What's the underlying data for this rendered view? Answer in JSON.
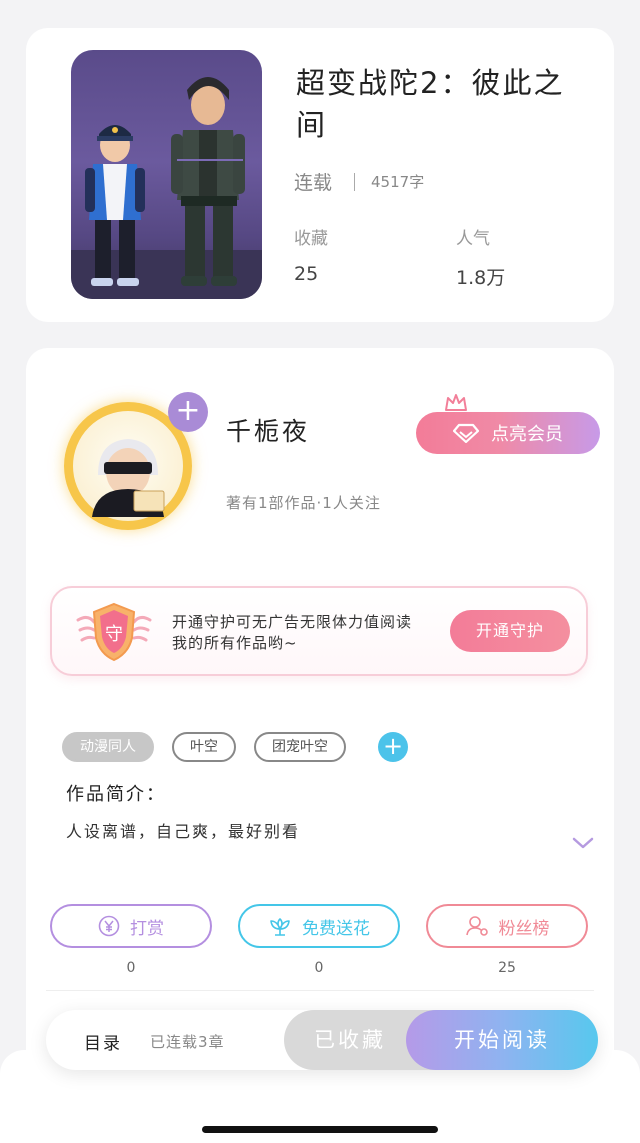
{
  "book": {
    "title": "超变战陀2：彼此之间",
    "status": "连载",
    "word_count": "4517字",
    "stats": [
      {
        "label": "收藏",
        "value": "25"
      },
      {
        "label": "人气",
        "value": "1.8万"
      }
    ]
  },
  "author": {
    "name": "千栀夜",
    "summary": "著有1部作品·1人关注",
    "vip_label": "点亮会员"
  },
  "guard": {
    "text": "开通守护可无广告无限体力值阅读我的所有作品哟~",
    "button_label": "开通守护",
    "badge_char": "守"
  },
  "tags": [
    "动漫同人",
    "叶空",
    "团宠叶空"
  ],
  "intro": {
    "label": "作品简介：",
    "text": "人设离谱，自己爽，最好别看"
  },
  "actions": [
    {
      "label": "打赏",
      "count": "0",
      "color": "#b48fe0",
      "icon": "yuan-coin-icon"
    },
    {
      "label": "免费送花",
      "count": "0",
      "color": "#44c6e8",
      "icon": "flower-icon"
    },
    {
      "label": "粉丝榜",
      "count": "25",
      "color": "#f08a96",
      "icon": "fans-icon"
    }
  ],
  "bottom_bar": {
    "catalog_label": "目录",
    "chapters_label": "已连载3章",
    "collected_label": "已收藏",
    "start_label": "开始阅读"
  }
}
